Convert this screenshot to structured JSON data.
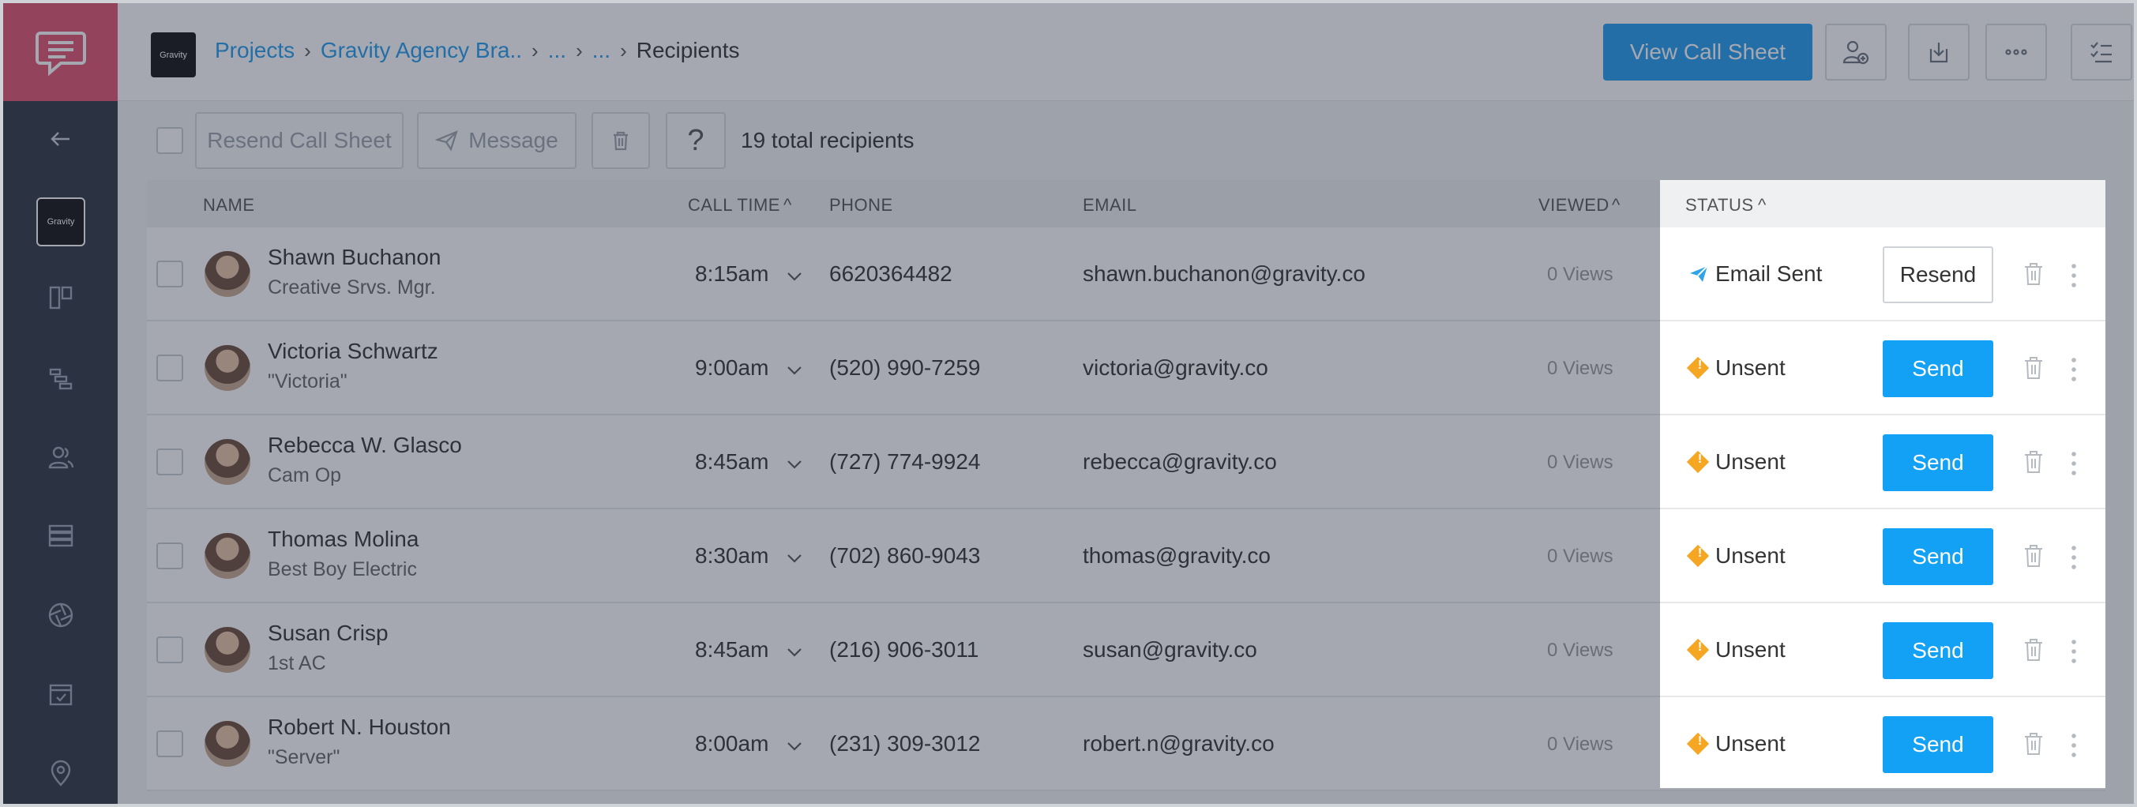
{
  "app": {
    "brand_logo_icon": "chat-bubble-icon",
    "project_thumb_label": "Gravity"
  },
  "breadcrumb": {
    "items": [
      "Projects",
      "Gravity Agency Bra..",
      "...",
      "..."
    ],
    "current": "Recipients"
  },
  "header": {
    "view_call_sheet": "View Call Sheet"
  },
  "toolbar": {
    "resend_label": "Resend Call Sheet",
    "message_label": "Message",
    "help_label": "?",
    "total": "19 total recipients"
  },
  "columns": {
    "name": "NAME",
    "call_time": "CALL TIME",
    "phone": "PHONE",
    "email": "EMAIL",
    "viewed": "VIEWED",
    "status": "STATUS"
  },
  "rows": [
    {
      "name": "Shawn Buchanon",
      "role": "Creative Srvs. Mgr.",
      "time": "8:15am",
      "phone": "6620364482",
      "email": "shawn.buchanon@gravity.co",
      "views": "0 Views",
      "status": "Email Sent",
      "action": "Resend"
    },
    {
      "name": "Victoria Schwartz",
      "role": "\"Victoria\"",
      "time": "9:00am",
      "phone": "(520) 990-7259",
      "email": "victoria@gravity.co",
      "views": "0 Views",
      "status": "Unsent",
      "action": "Send"
    },
    {
      "name": "Rebecca W. Glasco",
      "role": "Cam Op",
      "time": "8:45am",
      "phone": "(727) 774-9924",
      "email": "rebecca@gravity.co",
      "views": "0 Views",
      "status": "Unsent",
      "action": "Send"
    },
    {
      "name": "Thomas Molina",
      "role": "Best Boy Electric",
      "time": "8:30am",
      "phone": "(702) 860-9043",
      "email": "thomas@gravity.co",
      "views": "0 Views",
      "status": "Unsent",
      "action": "Send"
    },
    {
      "name": "Susan Crisp",
      "role": "1st AC",
      "time": "8:45am",
      "phone": "(216) 906-3011",
      "email": "susan@gravity.co",
      "views": "0 Views",
      "status": "Unsent",
      "action": "Send"
    },
    {
      "name": "Robert N. Houston",
      "role": "\"Server\"",
      "time": "8:00am",
      "phone": "(231) 309-3012",
      "email": "robert.n@gravity.co",
      "views": "0 Views",
      "status": "Unsent",
      "action": "Send"
    }
  ],
  "colors": {
    "accent": "#1f9cf0",
    "send": "#13a1f5",
    "brand": "#e0526e",
    "sidebar": "#2d3442",
    "unsent": "#f5a623"
  }
}
